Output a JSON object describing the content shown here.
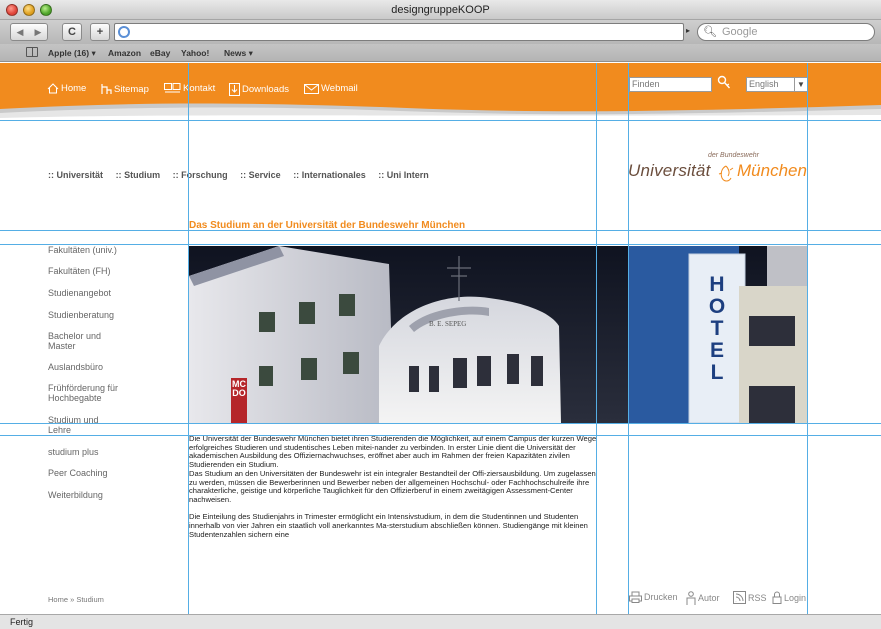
{
  "window": {
    "title": "designgruppeKOOP"
  },
  "toolbar": {
    "back_forward": [
      "◀",
      "▶"
    ],
    "reload_label": "C",
    "add_label": "+",
    "search_placeholder": "Google"
  },
  "bookmarks": {
    "items": [
      "Apple (16) ▾",
      "Amazon",
      "eBay",
      "Yahoo!",
      "News ▾"
    ]
  },
  "status": {
    "text": "Fertig"
  },
  "topnav": {
    "home": "Home",
    "sitemap": "Sitemap",
    "kontakt": "Kontakt",
    "downloads": "Downloads",
    "webmail": "Webmail"
  },
  "search": {
    "placeholder": "Finden"
  },
  "language": {
    "selected": "English"
  },
  "mainnav": [
    "Universität",
    "Studium",
    "Forschung",
    "Service",
    "Internationales",
    "Uni Intern"
  ],
  "mainnav_prefix": "::",
  "logo": {
    "small": "der Bundeswehr",
    "left": "Universität",
    "right": "München"
  },
  "heading": "Das Studium an der Universität der Bundeswehr München",
  "sidebar": {
    "items": [
      "Fakultäten (univ.)",
      "Fakultäten (FH)",
      "Studienangebot",
      "Studienberatung",
      "Bachelor und Master",
      "Auslandsbüro",
      "Frühförderung für Hochbegabte",
      "Studium und Lehre",
      "studium plus",
      "Peer Coaching",
      "Weiterbildung"
    ]
  },
  "hero": {
    "hotel_letters": [
      "H",
      "O",
      "T",
      "E",
      "L"
    ],
    "sign_text": "MCDO",
    "facade_text": "B. E. SEPEG"
  },
  "body": {
    "p1": "Die Universität der Bundeswehr München bietet ihren Studierenden die Möglichkeit, auf einem Campus der kurzen Wege erfolgreiches Studieren und studentisches Leben mitei-nander zu verbinden. In erster Linie dient die Universität der akademischen Ausbildung des Offiziernachwuchses, eröffnet aber auch im Rahmen der freien Kapazitäten zivilen Studierenden ein Studium.",
    "p2": "Das Studium an den Universitäten der Bundeswehr ist ein integraler Bestandteil der Offi-ziersausbildung. Um zugelassen zu werden, müssen die Bewerberinnen und Bewerber neben der allgemeinen Hochschul- oder Fachhochschulreife ihre charakterliche, geistige und körperliche Tauglichkeit für den Offizierberuf in einem zweitägigen Assessment-Center nachweisen.",
    "p3": "Die Einteilung des Studienjahrs in Trimester ermöglicht ein Intensivstudium, in dem die Studentinnen und Studenten innerhalb von vier Jahren ein staatlich voll anerkanntes Ma-sterstudium abschließen können. Studiengänge mit kleinen Studentenzahlen sichern eine"
  },
  "breadcrumb": "Home » Studium",
  "footer": {
    "drucken": "Drucken",
    "autor": "Autor",
    "rss": "RSS",
    "login": "Login"
  },
  "colors": {
    "accent": "#f18b1e",
    "guide": "#55aee5",
    "text": "#555555"
  }
}
